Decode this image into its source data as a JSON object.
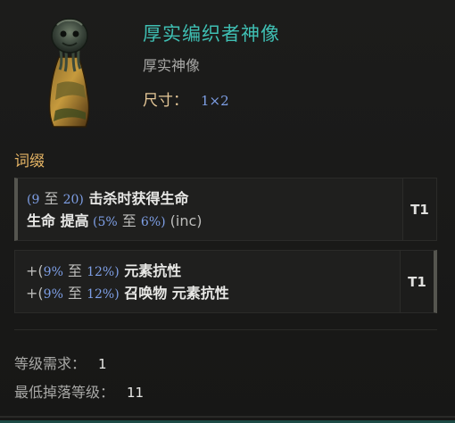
{
  "item": {
    "name": "厚实编织者神像",
    "base_type": "厚实神像",
    "size_label": "尺寸：",
    "size_value": "1×2",
    "art_icon": "idol-icon"
  },
  "affixes": {
    "title": "词缀",
    "groups": [
      {
        "tier": "T1",
        "line1": {
          "open": "(",
          "min": "9",
          "to": " 至 ",
          "max": "20",
          "close": ")",
          "text": " 击杀时获得生命"
        },
        "line2": {
          "text": "生命 提高",
          "open": " (",
          "min": "5%",
          "to": " 至 ",
          "max": "6%",
          "close": ")",
          "suffix": " (inc)"
        }
      },
      {
        "tier": "T1",
        "line1": {
          "prefix": "+(",
          "min": "9%",
          "to": " 至 ",
          "max": "12%",
          "close": ")",
          "text": " 元素抗性"
        },
        "line2": {
          "prefix": "+(",
          "min": "9%",
          "to": " 至 ",
          "max": "12%",
          "close": ")",
          "text": " 召唤物 元素抗性"
        }
      }
    ]
  },
  "requirements": {
    "level_label": "等级需求：",
    "level_value": "1",
    "drop_label": "最低掉落等级：",
    "drop_value": "11"
  },
  "colors": {
    "name": "#3fbfb3",
    "label_gold": "#e6c898",
    "numeric_blue": "#7e9fe6",
    "section_title": "#e6b565"
  }
}
